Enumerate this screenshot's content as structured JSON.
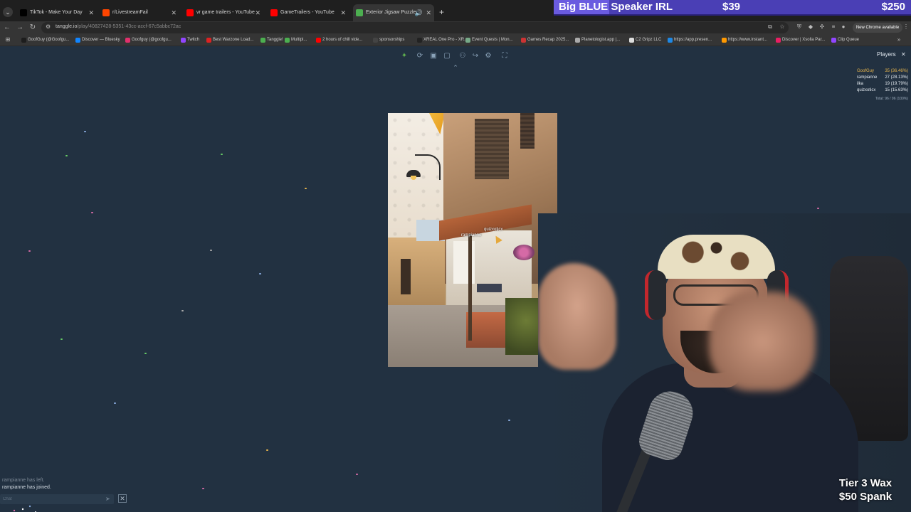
{
  "browser": {
    "tabs": [
      {
        "label": "TikTok - Make Your Day",
        "color": "#000000"
      },
      {
        "label": "r/LivestreamFail",
        "color": "#ff4500"
      },
      {
        "label": "vr game trailers - YouTube",
        "color": "#ff0000"
      },
      {
        "label": "GameTrailers - YouTube",
        "color": "#ff0000"
      },
      {
        "label": "Exterior Jigsaw Puzzle",
        "color": "#4caf50"
      }
    ],
    "url_host": "tanggle.io",
    "url_path": "/play/40827428-5351-43cc-accf-67c5abbc72ac",
    "update_label": "New Chrome available"
  },
  "bookmarks": [
    {
      "label": "GoofGuy (@Goofgu...",
      "color": "#1d1d1d"
    },
    {
      "label": "Discover — Bluesky",
      "color": "#1185fe"
    },
    {
      "label": "Goofguy (@goofgu...",
      "color": "#e1306c"
    },
    {
      "label": "Twitch",
      "color": "#9146ff"
    },
    {
      "label": "Best Warzone Load...",
      "color": "#d22"
    },
    {
      "label": "Tanggle!",
      "color": "#4caf50"
    },
    {
      "label": "Multipl...",
      "color": "#4caf50"
    },
    {
      "label": "2 hours of chill vide...",
      "color": "#ff0000"
    },
    {
      "label": "sponsorships",
      "color": "#444"
    },
    {
      "label": "XREAL One Pro - XR...",
      "color": "#222"
    },
    {
      "label": "Event Quests | Mon...",
      "color": "#7a8"
    },
    {
      "label": "Games Recap 2025...",
      "color": "#c33"
    },
    {
      "label": "Planetologist.app |...",
      "color": "#aaa"
    },
    {
      "label": "C2 Gripz LLC",
      "color": "#ddd"
    },
    {
      "label": "https://app.presen...",
      "color": "#1e88e5"
    },
    {
      "label": "https://www.instant...",
      "color": "#f90"
    },
    {
      "label": "Discover | Xsolla Par...",
      "color": "#e91e63"
    },
    {
      "label": "Clip Queue",
      "color": "#9146ff"
    }
  ],
  "stream_goal": {
    "title": "Big BLUE Speaker IRL",
    "current": "$39",
    "target": "$250",
    "progress_fraction": 0.156
  },
  "players": {
    "title": "Players",
    "list": [
      {
        "name": "GoofGuy",
        "score": "35 (36.46%)"
      },
      {
        "name": "rampianne",
        "score": "27 (28.13%)"
      },
      {
        "name": "ilka",
        "score": "19 (19.79%)"
      },
      {
        "name": "quizxoticx",
        "score": "15 (15.63%)"
      }
    ],
    "total": "Total: 96 / 96 (100%)"
  },
  "cursors": [
    {
      "name": "quizxoticx"
    },
    {
      "name": "rampianne"
    }
  ],
  "chat": {
    "lines": [
      {
        "text": "rampianne has left."
      },
      {
        "text": "rampianne has joined."
      }
    ],
    "placeholder": "Chat"
  },
  "webcam": {
    "caption_line1": "Tier 3 Wax",
    "caption_line2": "$50 Spank"
  }
}
